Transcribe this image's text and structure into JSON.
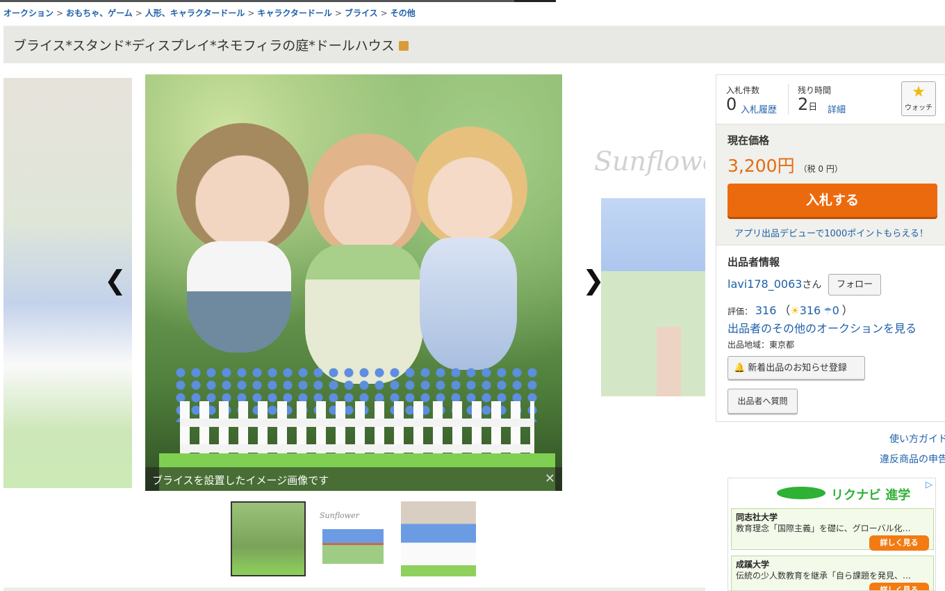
{
  "breadcrumb": {
    "items": [
      "オークション",
      "おもちゃ、ゲーム",
      "人形、キャラクタードール",
      "キャラクタードール",
      "ブライス",
      "その他"
    ],
    "separator": ">"
  },
  "item": {
    "title": "ブライス*スタンド*ディスプレイ*ネモフィラの庭*ドールハウス"
  },
  "gallery": {
    "caption": "ブライスを設置したイメージ画像です",
    "close_glyph": "✕",
    "prev_glyph": "❮",
    "next_glyph": "❯",
    "side_text": "Sunflowe",
    "thumb_text": "Sunflower",
    "thumbnails": 3,
    "selected_thumbnail": 1
  },
  "bid_info": {
    "bids_label": "入札件数",
    "bids_count": "0",
    "history_link": "入札履歴",
    "remaining_label": "残り時間",
    "remaining_value": "2",
    "remaining_unit": "日",
    "detail_link": "詳細",
    "watch_label": "ウォッチ",
    "watch_icon": "star-icon"
  },
  "price": {
    "label": "現在価格",
    "value": "3,200円",
    "tax": "（税 0 円）",
    "bid_button": "入札する",
    "promo": "アプリ出品デビューで1000ポイントもらえる！"
  },
  "seller": {
    "heading": "出品者情報",
    "name": "lavi178_0063",
    "honorific": "さん",
    "follow_button": "フォロー",
    "rating_label": "評価：",
    "rating_total": "316",
    "rating_open": "（",
    "rating_good": "316",
    "rating_bad": "0",
    "rating_close": "）",
    "other_auctions_link": "出品者のその他のオークションを見る",
    "region": "出品地域：東京都",
    "notify_button": "新着出品のお知らせ登録",
    "question_button": "出品者へ質問"
  },
  "links": {
    "guide": "使い方ガイド",
    "report": "違反商品の申告"
  },
  "ad": {
    "brand": "リクナビ 進学",
    "mark": "▷",
    "items": [
      {
        "university": "同志社大学",
        "desc": "教育理念「国際主義」を礎に、グローバル化…",
        "more": "詳しく見る"
      },
      {
        "university": "成蹊大学",
        "desc": "伝統の少人数教育を継承「自ら課題を発見、…",
        "more": "詳しく見る"
      }
    ]
  },
  "colors": {
    "accent_orange": "#ec6a0e",
    "price_orange": "#e56b10",
    "link_blue": "#1d5fa8",
    "title_bar": "#e8e8e4"
  }
}
